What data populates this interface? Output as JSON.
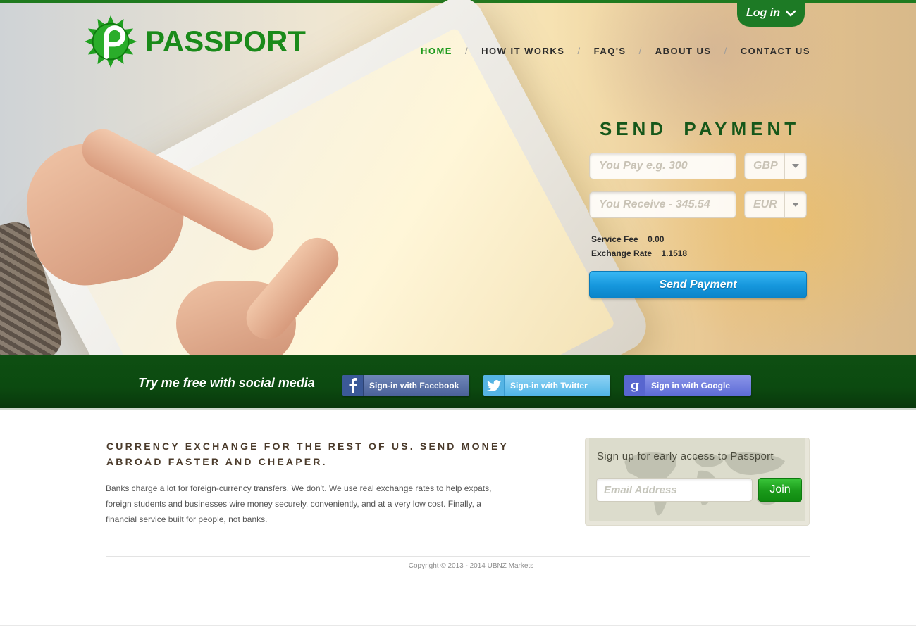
{
  "header": {
    "logo_text": "PASSPORT",
    "login_label": "Log in",
    "nav": [
      {
        "label": "HOME",
        "active": true
      },
      {
        "label": "HOW IT WORKS",
        "active": false
      },
      {
        "label": "FAQ'S",
        "active": false
      },
      {
        "label": "ABOUT US",
        "active": false
      },
      {
        "label": "CONTACT US",
        "active": false
      }
    ],
    "nav_separator": "/"
  },
  "send_payment": {
    "title": "SEND PAYMENT",
    "pay_placeholder": "You Pay e.g. 300",
    "pay_currency": "GBP",
    "receive_placeholder": "You Receive - 345.54",
    "receive_currency": "EUR",
    "service_fee_label": "Service Fee",
    "service_fee_value": "0.00",
    "exchange_rate_label": "Exchange Rate",
    "exchange_rate_value": "1.1518",
    "button_label": "Send Payment"
  },
  "social": {
    "tagline": "Try me free with social media",
    "facebook_label": "Sign-in with Facebook",
    "twitter_label": "Sign-in with Twitter",
    "google_label": "Sign in with Google"
  },
  "content": {
    "headline": "CURRENCY EXCHANGE FOR THE REST OF US. SEND MONEY ABROAD FASTER AND CHEAPER.",
    "body": "Banks charge a lot for foreign-currency transfers. We don't. We use real exchange rates to help expats, foreign students and businesses wire money securely,  conveniently, and  at a very  low cost. Finally, a financial service built for people, not banks."
  },
  "signup": {
    "title": "Sign up for early access to Passport",
    "email_placeholder": "Email Address",
    "join_label": "Join"
  },
  "footer": {
    "copyright": "Copyright © 2013 - 2014 UBNZ Markets"
  },
  "colors": {
    "brand_green": "#1a8a1a",
    "dark_green": "#0e4f12",
    "button_blue": "#1596dc"
  }
}
